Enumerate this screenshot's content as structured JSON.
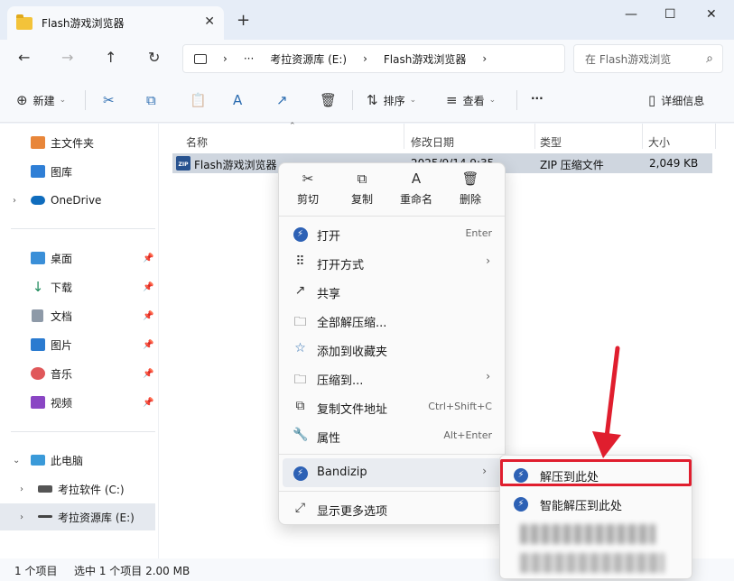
{
  "tab": {
    "title": "Flash游戏浏览器",
    "close": "✕",
    "new": "+"
  },
  "window": {
    "minimize": "—",
    "maximize": "☐",
    "close": "✕"
  },
  "nav_buttons": {
    "back": "←",
    "forward": "→",
    "up": "↑",
    "refresh": "↻"
  },
  "address": {
    "more": "···",
    "sep1": "›",
    "drive": "考拉资源库 (E:)",
    "sep2": "›",
    "folder": "Flash游戏浏览器",
    "sep3": "›"
  },
  "search": {
    "placeholder": "在 Flash游戏浏览",
    "icon": "⌕"
  },
  "toolbar": {
    "new_label": "新建",
    "new_icon": "⊕",
    "cut_icon": "✂",
    "copy_icon": "⧉",
    "paste_icon": "📋",
    "rename_icon": "A",
    "share_icon": "↗",
    "delete_icon": "🗑",
    "sort_label": "排序",
    "sort_icon": "⇅",
    "view_label": "查看",
    "view_icon": "≡",
    "more_label": "···",
    "details_label": "详细信息",
    "details_icon": "▯",
    "dropdown": "⌄"
  },
  "sidebar": {
    "chevron": "›",
    "pin": "📌",
    "expand": "⌄",
    "items": [
      {
        "label": "主文件夹"
      },
      {
        "label": "图库"
      },
      {
        "label": "OneDrive"
      },
      {
        "label": "桌面"
      },
      {
        "label": "下载"
      },
      {
        "label": "文档"
      },
      {
        "label": "图片"
      },
      {
        "label": "音乐"
      },
      {
        "label": "视频"
      },
      {
        "label": "此电脑"
      },
      {
        "label": "考拉软件 (C:)"
      },
      {
        "label": "考拉资源库 (E:)"
      }
    ]
  },
  "columns": {
    "name": "名称",
    "modified": "修改日期",
    "type": "类型",
    "size": "大小",
    "sort": "⌃"
  },
  "file": {
    "zip_badge": "ZIP",
    "name": "Flash游戏浏览器",
    "modified": "2025/9/14 9:35",
    "type": "ZIP 压缩文件",
    "size": "2,049 KB"
  },
  "status": {
    "count": "1 个项目",
    "selected": "选中 1 个项目  2.00 MB"
  },
  "context_menu": {
    "quick": [
      {
        "label": "剪切",
        "icon": "✂"
      },
      {
        "label": "复制",
        "icon": "⧉"
      },
      {
        "label": "重命名",
        "icon": "A"
      },
      {
        "label": "删除",
        "icon": "🗑"
      }
    ],
    "items": [
      {
        "label": "打开",
        "shortcut": "Enter",
        "icon": "⚡"
      },
      {
        "label": "打开方式",
        "arrow": "›",
        "icon": "⠿"
      },
      {
        "label": "共享",
        "icon": "↗"
      },
      {
        "label": "全部解压缩...",
        "icon": "🗀"
      },
      {
        "label": "添加到收藏夹",
        "icon": "☆"
      },
      {
        "label": "压缩到...",
        "arrow": "›",
        "icon": "🗀"
      },
      {
        "label": "复制文件地址",
        "shortcut": "Ctrl+Shift+C",
        "icon": "⧉"
      },
      {
        "label": "属性",
        "shortcut": "Alt+Enter",
        "icon": "🔧"
      },
      {
        "label": "Bandizip",
        "arrow": "›",
        "icon": "⚡"
      },
      {
        "label": "显示更多选项",
        "icon": "⤢"
      }
    ]
  },
  "submenu": {
    "items": [
      {
        "label": "解压到此处",
        "icon": "⚡"
      },
      {
        "label": "智能解压到此处",
        "icon": "⚡"
      }
    ]
  },
  "colors": {
    "accent": "#2d61b5",
    "highlight": "#e01e2e",
    "selection": "#cfd6df"
  }
}
